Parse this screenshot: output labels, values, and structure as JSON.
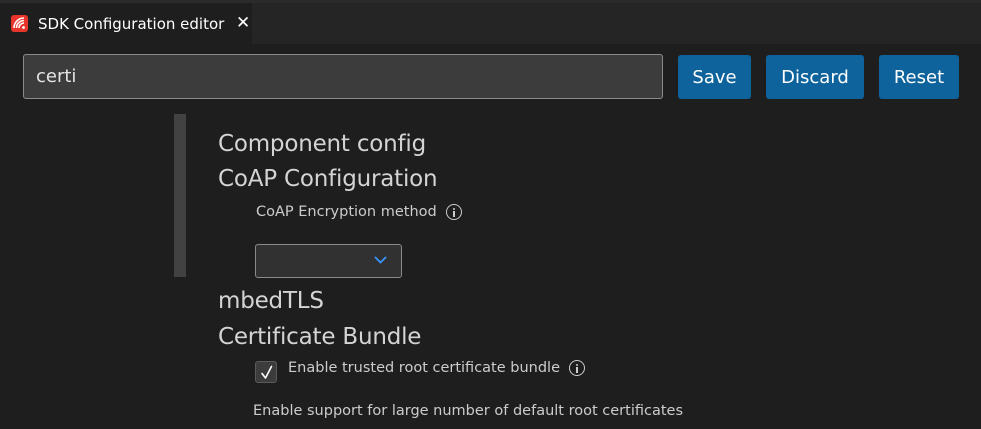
{
  "tab": {
    "title": "SDK Configuration editor",
    "close_symbol": "✕",
    "icon": "espressif-logo-icon"
  },
  "search": {
    "value": "certi"
  },
  "toolbar": {
    "save_label": "Save",
    "discard_label": "Discard",
    "reset_label": "Reset"
  },
  "content": {
    "section_component_config": "Component config",
    "section_coap": "CoAP Configuration",
    "coap_encryption_label": "CoAP Encryption method",
    "coap_encryption_value": "",
    "section_mbedtls": "mbedTLS",
    "section_cert_bundle": "Certificate Bundle",
    "cert_bundle_checkbox_label": "Enable trusted root certificate bundle",
    "cert_bundle_checked": true,
    "cert_bundle_description": "Enable support for large number of default root certificates"
  },
  "colors": {
    "accent": "#0e639c",
    "background": "#1e1e1e",
    "tab_icon": "#e7352c",
    "chevron": "#3794ff"
  }
}
